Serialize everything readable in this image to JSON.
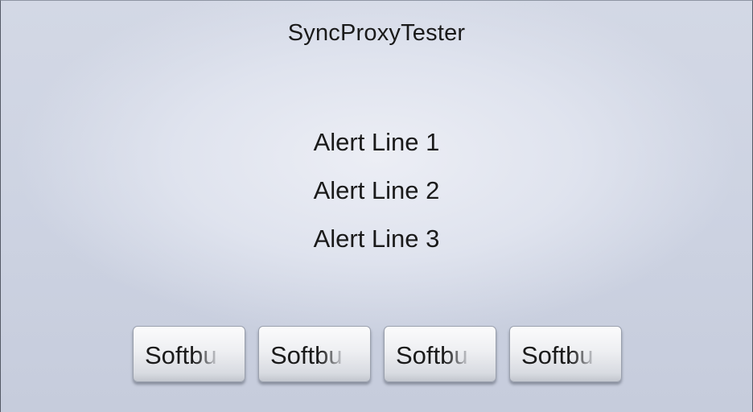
{
  "app": {
    "title": "SyncProxyTester"
  },
  "alert": {
    "lines": [
      "Alert Line 1",
      "Alert Line 2",
      "Alert Line 3"
    ]
  },
  "softbuttons": [
    {
      "label": "Softbu"
    },
    {
      "label": "Softbu"
    },
    {
      "label": "Softbu"
    },
    {
      "label": "Softbu"
    }
  ]
}
